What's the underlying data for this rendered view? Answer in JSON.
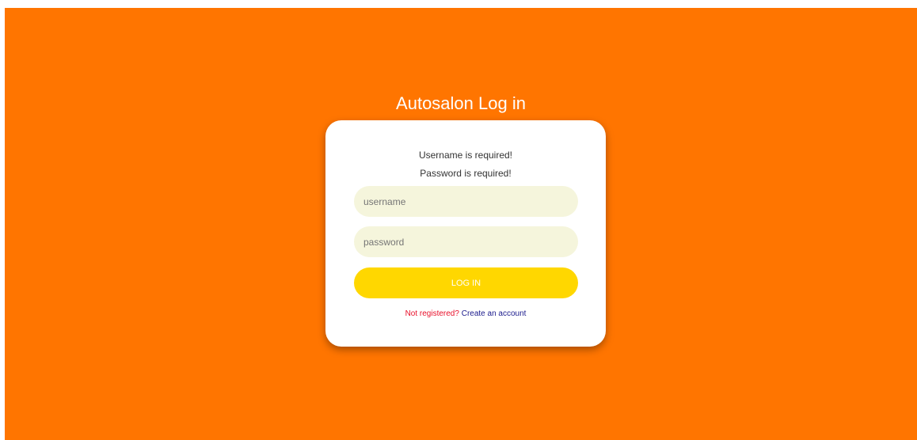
{
  "header": {
    "title": "Autosalon Log in"
  },
  "form": {
    "errors": [
      "Username is required!",
      "Password is required!"
    ],
    "username": {
      "value": "",
      "placeholder": "username"
    },
    "password": {
      "value": "",
      "placeholder": "password"
    },
    "login_label": "LOG IN",
    "register_question": "Not registered?",
    "register_link": "Create an account"
  },
  "colors": {
    "background": "#ff7500",
    "card": "#ffffff",
    "input_bg": "#f5f5dc",
    "button_bg": "#ffd700",
    "register_question": "#e8102a",
    "register_link": "#1a1a8c"
  }
}
